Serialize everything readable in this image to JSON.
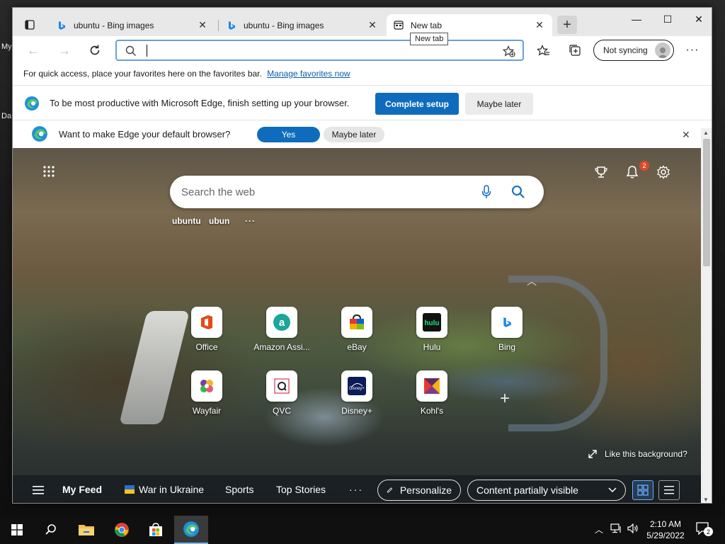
{
  "desktop": {
    "fragment_top": "My",
    "fragment_mid": "Da"
  },
  "tabs": [
    {
      "label": "ubuntu - Bing images"
    },
    {
      "label": "ubuntu - Bing images"
    },
    {
      "label": "New tab"
    }
  ],
  "tooltip": "New tab",
  "addressbar": {
    "value": "",
    "placeholder": ""
  },
  "toolbar": {
    "sync_label": "Not syncing"
  },
  "favbar": {
    "text": "For quick access, place your favorites here on the favorites bar.",
    "link": "Manage favorites now"
  },
  "setup_banner": {
    "message": "To be most productive with Microsoft Edge, finish setting up your browser.",
    "primary": "Complete setup",
    "secondary": "Maybe later"
  },
  "default_banner": {
    "message": "Want to make Edge your default browser?",
    "yes": "Yes",
    "later": "Maybe later"
  },
  "ntp": {
    "search_placeholder": "Search the web",
    "recent_searches": [
      "ubuntu",
      "ubun"
    ],
    "notification_count": "2",
    "tiles": [
      {
        "label": "Office"
      },
      {
        "label": "Amazon Assi..."
      },
      {
        "label": "eBay"
      },
      {
        "label": "Hulu"
      },
      {
        "label": "Bing"
      },
      {
        "label": "Wayfair"
      },
      {
        "label": "QVC"
      },
      {
        "label": "Disney+"
      },
      {
        "label": "Kohl's"
      }
    ],
    "like_background": "Like this background?"
  },
  "feed": {
    "my_feed": "My Feed",
    "items": [
      "War in Ukraine",
      "Sports",
      "Top Stories"
    ],
    "personalize": "Personalize",
    "content_visibility": "Content partially visible"
  },
  "taskbar": {
    "time": "2:10 AM",
    "date": "5/29/2022",
    "notifications": "2"
  }
}
